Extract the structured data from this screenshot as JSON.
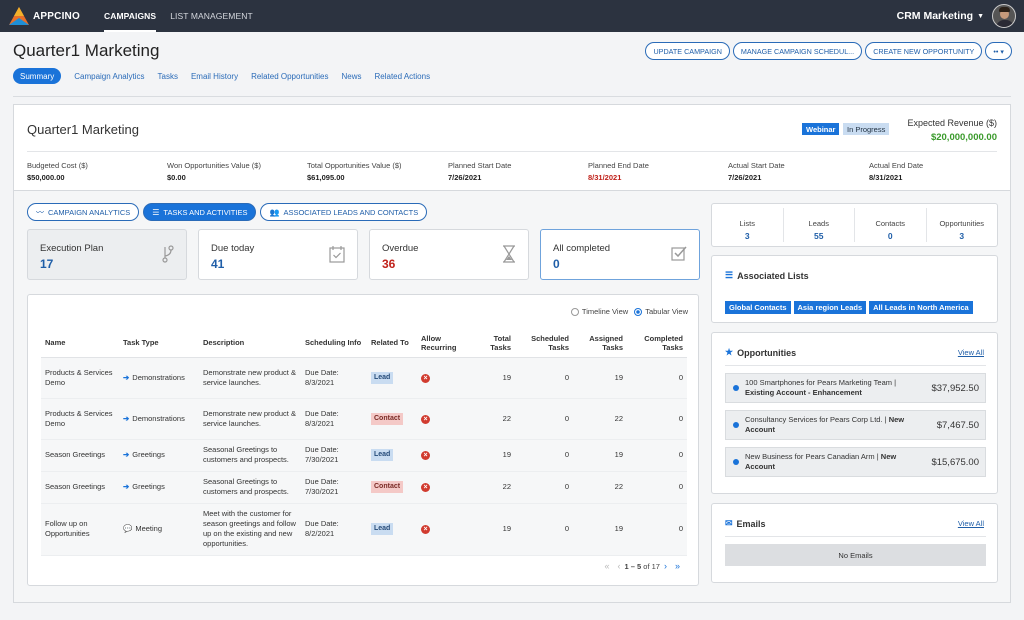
{
  "app": {
    "brand": "APPCINO",
    "nav": [
      {
        "label": "CAMPAIGNS",
        "active": true
      },
      {
        "label": "LIST MANAGEMENT",
        "active": false
      }
    ],
    "org_name": "CRM Marketing"
  },
  "page": {
    "title": "Quarter1 Marketing",
    "actions": [
      "UPDATE CAMPAIGN",
      "MANAGE CAMPAIGN SCHEDUL...",
      "CREATE NEW OPPORTUNITY"
    ],
    "more_label": "•• ▾",
    "tabs": [
      "Summary",
      "Campaign Analytics",
      "Tasks",
      "Email History",
      "Related Opportunities",
      "News",
      "Related Actions"
    ]
  },
  "summary": {
    "title": "Quarter1 Marketing",
    "badges": [
      "Webinar",
      "In Progress"
    ],
    "expected_revenue_label": "Expected Revenue ($)",
    "expected_revenue": "$20,000,000.00",
    "metrics": [
      {
        "label": "Budgeted Cost ($)",
        "value": "$50,000.00"
      },
      {
        "label": "Won Opportunities Value ($)",
        "value": "$0.00"
      },
      {
        "label": "Total Opportunities Value ($)",
        "value": "$61,095.00"
      },
      {
        "label": "Planned Start Date",
        "value": "7/26/2021"
      },
      {
        "label": "Planned End Date",
        "value": "8/31/2021"
      },
      {
        "label": "Actual Start Date",
        "value": "7/26/2021"
      },
      {
        "label": "Actual End Date",
        "value": "8/31/2021"
      }
    ]
  },
  "subtabs": [
    "CAMPAIGN ANALYTICS",
    "TASKS AND ACTIVITIES",
    "ASSOCIATED LEADS AND CONTACTS"
  ],
  "tiles": [
    {
      "label": "Execution Plan",
      "value": "17"
    },
    {
      "label": "Due today",
      "value": "41"
    },
    {
      "label": "Overdue",
      "value": "36"
    },
    {
      "label": "All completed",
      "value": "0"
    }
  ],
  "views": {
    "timeline": "Timeline View",
    "tabular": "Tabular View",
    "selected": "tabular"
  },
  "table": {
    "headers": [
      "Name",
      "Task Type",
      "Description",
      "Scheduling Info",
      "Related To",
      "Allow Recurring",
      "Total Tasks",
      "Scheduled Tasks",
      "Assigned Tasks",
      "Completed Tasks"
    ],
    "rows": [
      {
        "name": "Products & Services Demo",
        "type": "Demonstrations",
        "desc": "Demonstrate new product & service launches.",
        "sched": "Due Date: 8/3/2021",
        "related": "Lead",
        "total": "19",
        "scheduled": "0",
        "assigned": "19",
        "completed": "0"
      },
      {
        "name": "Products & Services Demo",
        "type": "Demonstrations",
        "desc": "Demonstrate new product & service launches.",
        "sched": "Due Date: 8/3/2021",
        "related": "Contact",
        "total": "22",
        "scheduled": "0",
        "assigned": "22",
        "completed": "0"
      },
      {
        "name": "Season Greetings",
        "type": "Greetings",
        "desc": "Seasonal Greetings to customers and prospects.",
        "sched": "Due Date: 7/30/2021",
        "related": "Lead",
        "total": "19",
        "scheduled": "0",
        "assigned": "19",
        "completed": "0"
      },
      {
        "name": "Season Greetings",
        "type": "Greetings",
        "desc": "Seasonal Greetings to customers and prospects.",
        "sched": "Due Date: 7/30/2021",
        "related": "Contact",
        "total": "22",
        "scheduled": "0",
        "assigned": "22",
        "completed": "0"
      },
      {
        "name": "Follow up on Opportunities",
        "type": "Meeting",
        "desc": "Meet with the customer for season greetings and follow up on the existing and new opportunities.",
        "sched": "Due Date: 8/2/2021",
        "related": "Lead",
        "total": "19",
        "scheduled": "0",
        "assigned": "19",
        "completed": "0"
      }
    ],
    "pager_range": "1 – 5",
    "pager_total": "of 17"
  },
  "counts": [
    {
      "label": "Lists",
      "value": "3"
    },
    {
      "label": "Leads",
      "value": "55"
    },
    {
      "label": "Contacts",
      "value": "0"
    },
    {
      "label": "Opportunities",
      "value": "3"
    }
  ],
  "associated_lists": {
    "title": "Associated Lists",
    "items": [
      "Global Contacts",
      "Asia region Leads",
      "All Leads in North America"
    ]
  },
  "opportunities": {
    "title": "Opportunities",
    "view_all": "View All",
    "items": [
      {
        "name": "100 Smartphones for Pears Marketing Team |",
        "type": "Existing Account - Enhancement",
        "amount": "$37,952.50"
      },
      {
        "name": "Consultancy Services for Pears Corp Ltd. |",
        "type": "New Account",
        "amount": "$7,467.50"
      },
      {
        "name": "New Business for Pears Canadian Arm |",
        "type": "New Account",
        "amount": "$15,675.00"
      }
    ]
  },
  "emails": {
    "title": "Emails",
    "view_all": "View All",
    "empty": "No Emails"
  },
  "colors": {
    "accent": "#1a73d9",
    "nav_bg": "#2c3340",
    "positive": "#3a9a2b",
    "danger": "#c0211a"
  }
}
